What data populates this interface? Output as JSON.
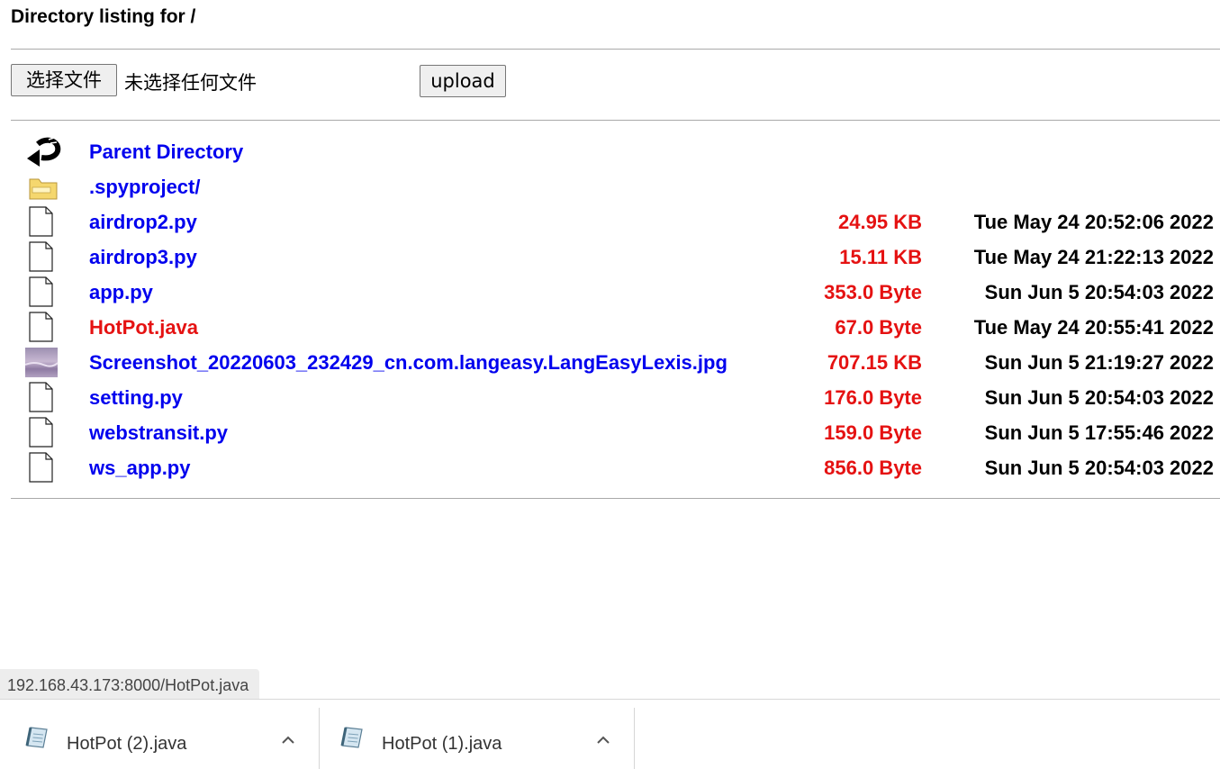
{
  "header": {
    "title": "Directory listing for /"
  },
  "upload_form": {
    "choose_file_label": "选择文件",
    "no_file_text": "未选择任何文件",
    "upload_label": "upload"
  },
  "listing": [
    {
      "name": "Parent Directory",
      "icon": "back-arrow-icon",
      "size": "",
      "date": ""
    },
    {
      "name": ".spyproject/",
      "icon": "folder-icon",
      "size": "",
      "date": ""
    },
    {
      "name": "airdrop2.py",
      "icon": "file-icon",
      "size": "24.95 KB",
      "date": "Tue May 24 20:52:06 2022"
    },
    {
      "name": "airdrop3.py",
      "icon": "file-icon",
      "size": "15.11 KB",
      "date": "Tue May 24 21:22:13 2022"
    },
    {
      "name": "app.py",
      "icon": "file-icon",
      "size": "353.0 Byte",
      "date": "Sun Jun 5 20:54:03 2022"
    },
    {
      "name": "HotPot.java",
      "icon": "file-icon",
      "size": "67.0 Byte",
      "date": "Tue May 24 20:55:41 2022",
      "visited": true
    },
    {
      "name": "Screenshot_20220603_232429_cn.com.langeasy.LangEasyLexis.jpg",
      "icon": "image-thumbnail-icon",
      "size": "707.15 KB",
      "date": "Sun Jun 5 21:19:27 2022"
    },
    {
      "name": "setting.py",
      "icon": "file-icon",
      "size": "176.0 Byte",
      "date": "Sun Jun 5 20:54:03 2022"
    },
    {
      "name": "webstransit.py",
      "icon": "file-icon",
      "size": "159.0 Byte",
      "date": "Sun Jun 5 17:55:46 2022"
    },
    {
      "name": "ws_app.py",
      "icon": "file-icon",
      "size": "856.0 Byte",
      "date": "Sun Jun 5 20:54:03 2022"
    }
  ],
  "status_bar": {
    "url": "192.168.43.173:8000/HotPot.java"
  },
  "downloads": [
    {
      "name": "HotPot (2).java",
      "icon": "java-file-icon"
    },
    {
      "name": "HotPot (1).java",
      "icon": "java-file-icon"
    }
  ],
  "colors": {
    "link": "#0000ee",
    "visited_link": "#e51212",
    "size_text": "#e51212",
    "separator": "#a9a9a9"
  }
}
